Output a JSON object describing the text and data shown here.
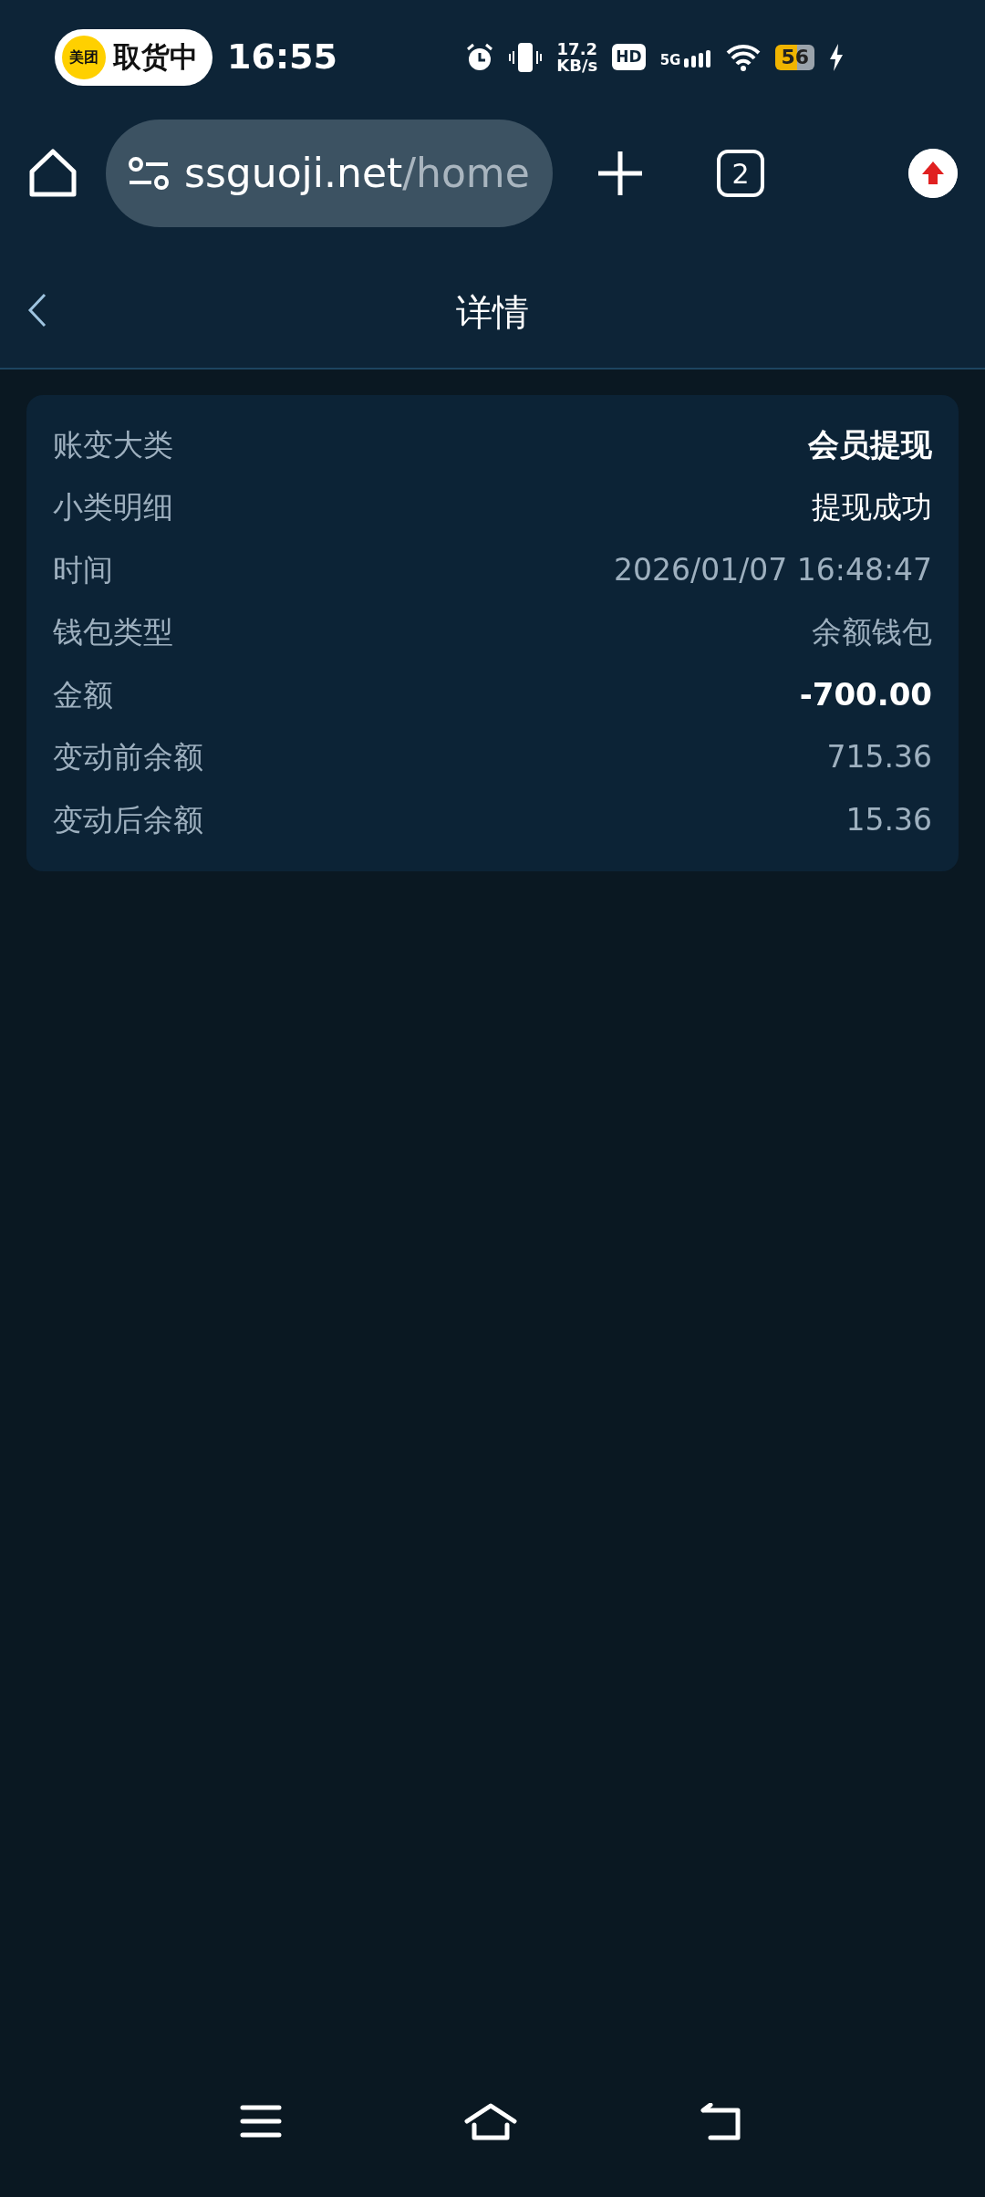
{
  "status_bar": {
    "app_badge": "美团",
    "app_status": "取货中",
    "time": "16:55",
    "net_speed": "17.2",
    "net_unit": "KB/s",
    "hd": "HD",
    "network": "5G",
    "battery": "56"
  },
  "browser": {
    "url_host": "ssguoji.net",
    "url_path": "/home",
    "tab_count": "2"
  },
  "header": {
    "title": "详情"
  },
  "details": [
    {
      "label": "账变大类",
      "value": "会员提现",
      "kind": "bold"
    },
    {
      "label": "小类明细",
      "value": "提现成功",
      "kind": "bright"
    },
    {
      "label": "时间",
      "value": "2026/01/07 16:48:47",
      "kind": "muted"
    },
    {
      "label": "钱包类型",
      "value": "余额钱包",
      "kind": "muted"
    },
    {
      "label": "金额",
      "value": "-700.00",
      "kind": "bold"
    },
    {
      "label": "变动前余额",
      "value": "715.36",
      "kind": "muted"
    },
    {
      "label": "变动后余额",
      "value": "15.36",
      "kind": "muted"
    }
  ]
}
